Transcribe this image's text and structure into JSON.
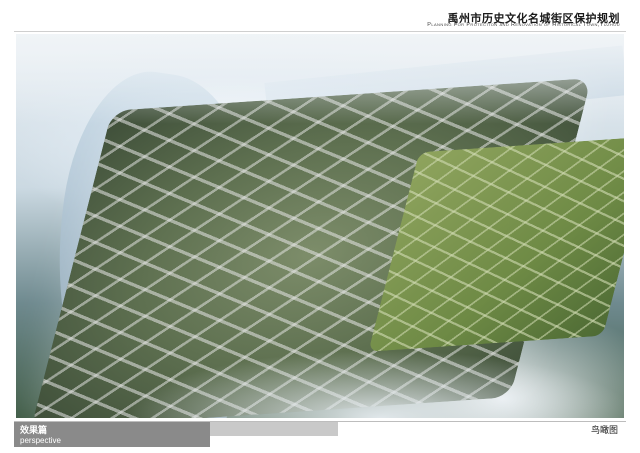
{
  "header": {
    "title_cn": "禹州市历史文化名城街区保护规划",
    "title_en": "Planning For Protection and Renovation of Historical Town,Yuzhou"
  },
  "footer": {
    "section_cn": "效果篇",
    "section_en": "perspective",
    "view_cn": "鸟瞰图"
  }
}
